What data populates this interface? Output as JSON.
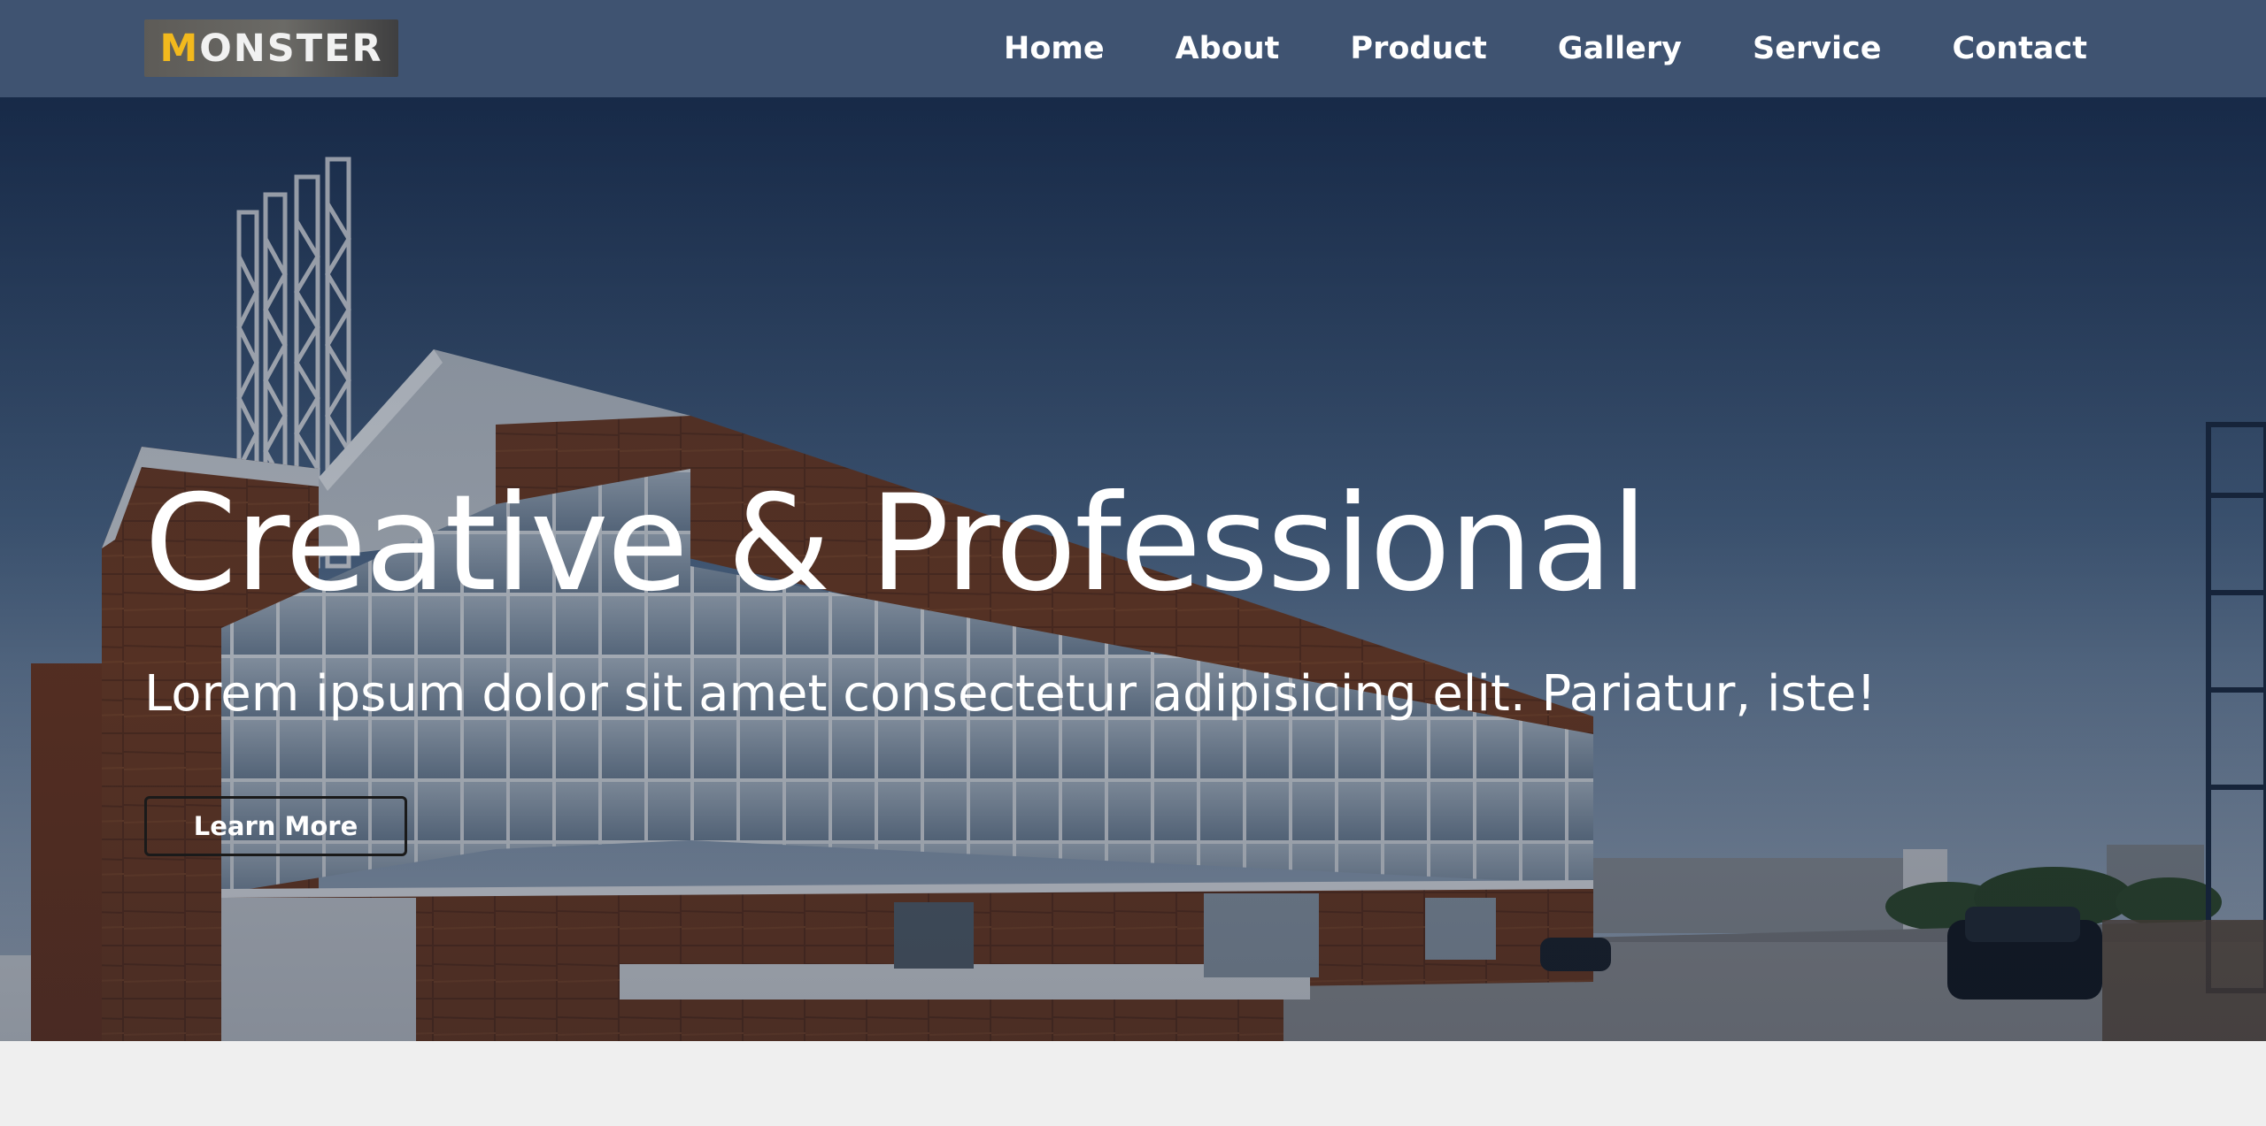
{
  "brand": {
    "logo_first_letter": "M",
    "logo_rest": "ONSTER",
    "accent_color": "#f2b91d",
    "nav_background": "#3f5371"
  },
  "nav": {
    "items": [
      {
        "label": "Home"
      },
      {
        "label": "About"
      },
      {
        "label": "Product"
      },
      {
        "label": "Gallery"
      },
      {
        "label": "Service"
      },
      {
        "label": "Contact"
      }
    ]
  },
  "hero": {
    "title": "Creative & Professional",
    "subtitle": "Lorem ipsum dolor sit amet consectetur adipisicing elit. Pariatur, iste!",
    "cta_label": "Learn More",
    "background_image": "modern-building-photo"
  }
}
